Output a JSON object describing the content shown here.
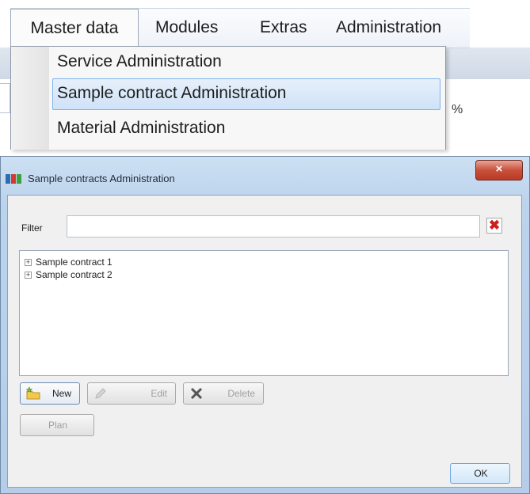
{
  "menu": {
    "bar_items": [
      "Master data",
      "Modules",
      "Extras",
      "Administration"
    ],
    "dropdown_items": [
      "Service Administration",
      "Sample contract Administration",
      "Material Administration"
    ],
    "highlighted_item": "Sample contract Administration",
    "background_suffix": "%"
  },
  "dialog": {
    "title": "Sample contracts Administration",
    "close_symbol": "×",
    "filter": {
      "label": "Filter",
      "value": "",
      "clear_symbol": "✖"
    },
    "tree_items": [
      {
        "expander": "+",
        "label": "Sample contract 1"
      },
      {
        "expander": "+",
        "label": "Sample contract 2"
      }
    ],
    "buttons": {
      "new": "New",
      "edit": "Edit",
      "delete": "Delete",
      "plan": "Plan",
      "ok": "OK"
    },
    "states": {
      "edit_enabled": false,
      "delete_enabled": false,
      "plan_enabled": false
    },
    "icons": {
      "app": "app-icon",
      "new": "folder-star-icon",
      "edit": "pencil-icon",
      "delete": "x-icon",
      "clear_filter": "red-x-icon"
    },
    "colors": {
      "highlight_border": "#7eb4ea",
      "close_button": "#c8503a",
      "clear_filter_icon": "#cc1f1f"
    }
  }
}
